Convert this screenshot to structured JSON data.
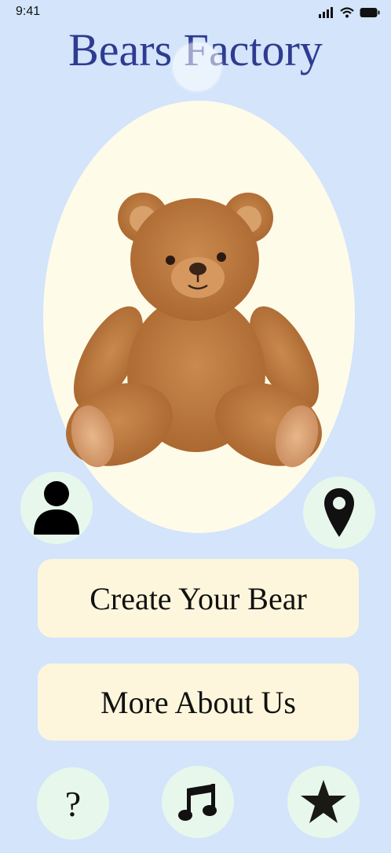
{
  "status_bar": {
    "time": "9:41"
  },
  "header": {
    "title": "Bears Factory"
  },
  "hero": {
    "image": "teddy-bear"
  },
  "actions": {
    "profile_icon": "person-icon",
    "location_icon": "map-pin-icon",
    "create_label": "Create Your Bear",
    "about_label": "More About Us"
  },
  "bottom_nav": {
    "help_glyph": "?",
    "music_icon": "music-note-icon",
    "favorite_icon": "star-icon"
  },
  "colors": {
    "background": "#d3e4fb",
    "title": "#2e3b8f",
    "oval": "#fffbe9",
    "button": "#fdf6dc",
    "circle": "#e8f7ec",
    "bear": "#b8763f"
  }
}
